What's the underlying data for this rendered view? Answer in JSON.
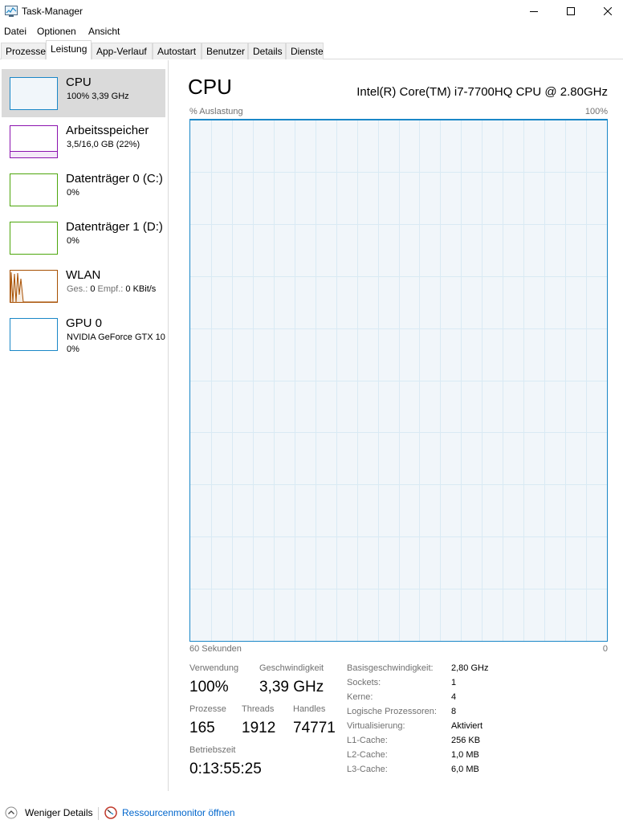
{
  "window": {
    "title": "Task-Manager",
    "icons": {
      "app": "task-manager-icon",
      "minimize": "minimize-icon",
      "maximize": "maximize-icon",
      "close": "close-icon"
    }
  },
  "menu": {
    "items": [
      "Datei",
      "Optionen",
      "Ansicht"
    ]
  },
  "tabs": {
    "items": [
      "Prozesse",
      "Leistung",
      "App-Verlauf",
      "Autostart",
      "Benutzer",
      "Details",
      "Dienste"
    ],
    "active": "Leistung"
  },
  "sidebar": {
    "items": [
      {
        "name": "CPU",
        "sub": "100%  3,39 GHz",
        "sub2": "",
        "color": "#1a87c7",
        "selected": true
      },
      {
        "name": "Arbeitsspeicher",
        "sub": "3,5/16,0 GB (22%)",
        "sub2": "",
        "color": "#8b12ae"
      },
      {
        "name": "Datenträger 0 (C:)",
        "sub": "0%",
        "sub2": "",
        "color": "#4da60c"
      },
      {
        "name": "Datenträger 1 (D:)",
        "sub": "0%",
        "sub2": "",
        "color": "#4da60c"
      },
      {
        "name": "WLAN",
        "sub_gray1": "Ges.:",
        "sub_val1": "0",
        "sub_gray2": "Empf.:",
        "sub_val2": "0 KBit/s",
        "color": "#a74f01"
      },
      {
        "name": "GPU 0",
        "sub": "NVIDIA GeForce GTX 10",
        "sub2": "0%",
        "color": "#1a87c7"
      }
    ]
  },
  "main": {
    "title": "CPU",
    "model": "Intel(R) Core(TM) i7-7700HQ CPU @ 2.80GHz",
    "graph": {
      "y_label": "% Auslastung",
      "y_max": "100%",
      "x_left": "60 Sekunden",
      "x_right": "0",
      "line_color": "#1a87c7",
      "fill_color": "#f1f6fa",
      "grid_color": "#d9eaf4",
      "usage_percent": 100
    },
    "stats": {
      "usage_label": "Verwendung",
      "usage_value": "100%",
      "speed_label": "Geschwindigkeit",
      "speed_value": "3,39 GHz",
      "processes_label": "Prozesse",
      "processes_value": "165",
      "threads_label": "Threads",
      "threads_value": "1912",
      "handles_label": "Handles",
      "handles_value": "74771",
      "uptime_label": "Betriebszeit",
      "uptime_value": "0:13:55:25"
    },
    "info": [
      {
        "label": "Basisgeschwindigkeit:",
        "value": "2,80 GHz"
      },
      {
        "label": "Sockets:",
        "value": "1"
      },
      {
        "label": "Kerne:",
        "value": "4"
      },
      {
        "label": "Logische Prozessoren:",
        "value": "8"
      },
      {
        "label": "Virtualisierung:",
        "value": "Aktiviert"
      },
      {
        "label": "L1-Cache:",
        "value": "256 KB"
      },
      {
        "label": "L2-Cache:",
        "value": "1,0 MB"
      },
      {
        "label": "L3-Cache:",
        "value": "6,0 MB"
      }
    ]
  },
  "footer": {
    "less_details": "Weniger Details",
    "resource_monitor": "Ressourcenmonitor öffnen",
    "link_color": "#0066cc"
  }
}
